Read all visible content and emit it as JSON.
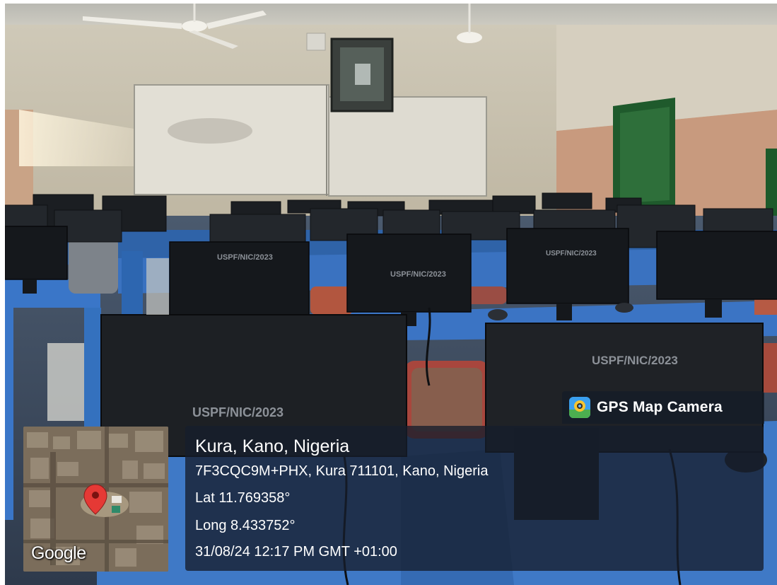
{
  "stamp": {
    "app_name": "GPS Map Camera",
    "app_icon": "gps-map-camera-icon",
    "location_title": "Kura, Kano, Nigeria",
    "address": "7F3CQC9M+PHX, Kura 711101, Kano, Nigeria",
    "latitude": "Lat 11.769358°",
    "longitude": "Long 8.433752°",
    "datetime": "31/08/24 12:17 PM GMT +01:00",
    "map_attribution": "Google",
    "map_pin_icon": "map-pin-icon"
  },
  "monitor_label": "USPF/NIC/2023",
  "colors": {
    "desk_blue": "#2f6fc4",
    "wall": "#d8d2c0",
    "pin_red": "#e53935",
    "overlay": "#161e2c"
  }
}
